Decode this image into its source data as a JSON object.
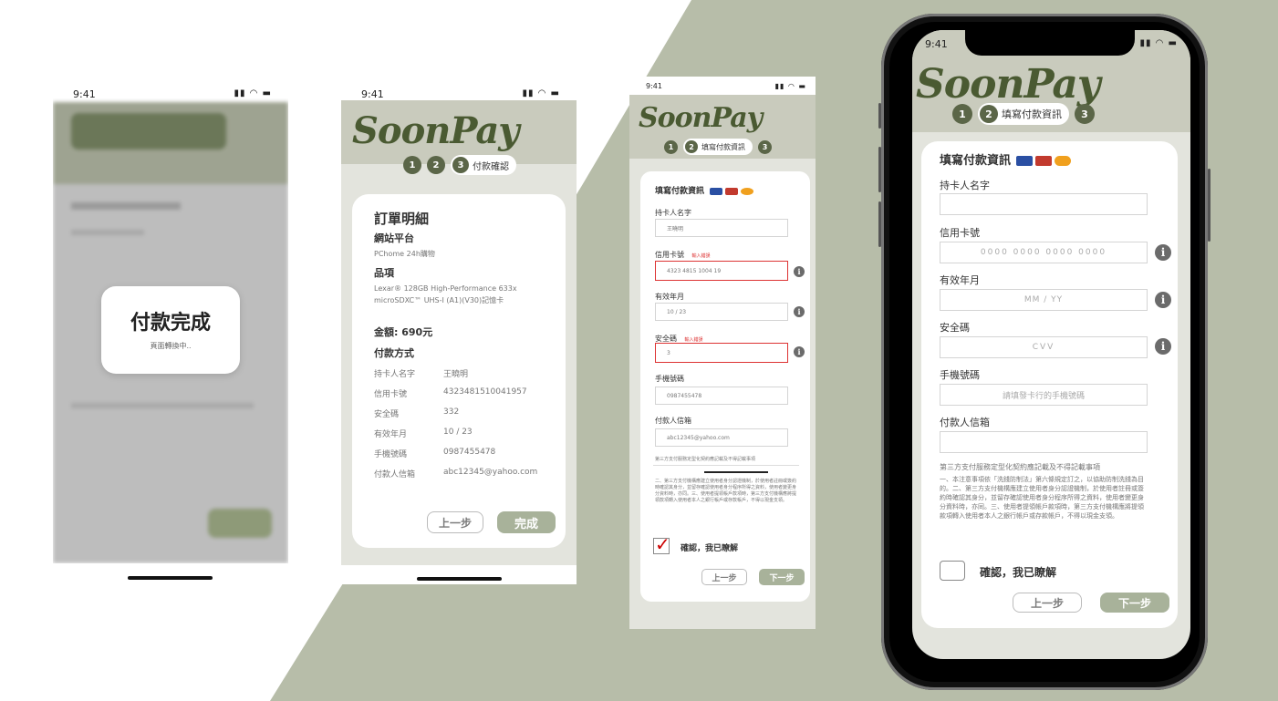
{
  "colors": {
    "bg_shape": "#b7bda9",
    "header": "#c9cbbd",
    "accent": "#4a5a32",
    "button_primary": "#a8b29a",
    "error": "#d33333"
  },
  "brand": "SoonPay",
  "status": {
    "time": "9:41"
  },
  "steps": {
    "s1": "1",
    "s2": "2",
    "s3": "3",
    "fill_label": "填寫付款資訊",
    "confirm_label": "付款確認"
  },
  "screen1": {
    "dialog_title": "付款完成",
    "dialog_sub": "頁面轉換中.."
  },
  "screen2": {
    "heading": "訂單明細",
    "site_label": "網站平台",
    "site_value": "PChome 24h購物",
    "item_label": "品項",
    "item_value": "Lexar® 128GB High-Performance 633x microSDXC™ UHS-I (A1)(V30)記憶卡",
    "amount": "金額: 690元",
    "method_label": "付款方式",
    "rows": [
      {
        "k": "持卡人名字",
        "v": "王曉明"
      },
      {
        "k": "信用卡號",
        "v": "4323481510041957"
      },
      {
        "k": "安全碼",
        "v": "332"
      },
      {
        "k": "有效年月",
        "v": "10 / 23"
      },
      {
        "k": "手機號碼",
        "v": "0987455478"
      },
      {
        "k": "付款人信箱",
        "v": "abc12345@yahoo.com"
      }
    ],
    "back": "上一步",
    "done": "完成"
  },
  "screen3": {
    "title": "填寫付款資訊",
    "name_label": "持卡人名字",
    "name_value": "王曉明",
    "card_label": "信用卡號",
    "card_err": "輸入錯誤",
    "card_value": "4323 4815 1004 19",
    "exp_label": "有效年月",
    "exp_value": "10 / 23",
    "cvv_label": "安全碼",
    "cvv_err": "輸入錯誤",
    "cvv_value": "3",
    "phone_label": "手機號碼",
    "phone_value": "0987455478",
    "email_label": "付款人信箱",
    "email_value": "abc12345@yahoo.com",
    "terms_title": "第三方支付服務定型化契約應記載及不得記載事項",
    "terms_body": "二、第三方支付機構應建立使用者身分認證機制，於使用者註冊或簽約時確認其身分，並留存確認使用者身分程序所得之資料，使用者變更身分資料時，亦同。三、使用者提領帳戶款項時，第三方支付機構應將提領款項轉入使用者本人之銀行帳戶或存款帳戶，不得以現金支領。",
    "confirm": "確認，我已瞭解",
    "back": "上一步",
    "next": "下一步"
  },
  "screen4": {
    "title": "填寫付款資訊",
    "name_label": "持卡人名字",
    "card_label": "信用卡號",
    "card_ph": "0000 0000 0000 0000",
    "exp_label": "有效年月",
    "exp_ph": "MM / YY",
    "cvv_label": "安全碼",
    "cvv_ph": "CVV",
    "phone_label": "手機號碼",
    "phone_ph": "請填發卡行的手機號碼",
    "email_label": "付款人信箱",
    "terms_title": "第三方支付服務定型化契約應記載及不得記載事項",
    "terms_body": "一、本注意事項依「洗錢防制法」第六條規定訂之，以協助防制洗錢為目的。二、第三方支付機構應建立使用者身分認證機制，於使用者註冊或簽約時確認其身分，並留存確認使用者身分程序所得之資料，使用者變更身分資料時，亦同。三、使用者提領帳戶款項時，第三方支付機構應將提領款項轉入使用者本人之銀行帳戶或存款帳戶，不得以現金支領。",
    "confirm": "確認，我已瞭解",
    "back": "上一步",
    "next": "下一步"
  }
}
